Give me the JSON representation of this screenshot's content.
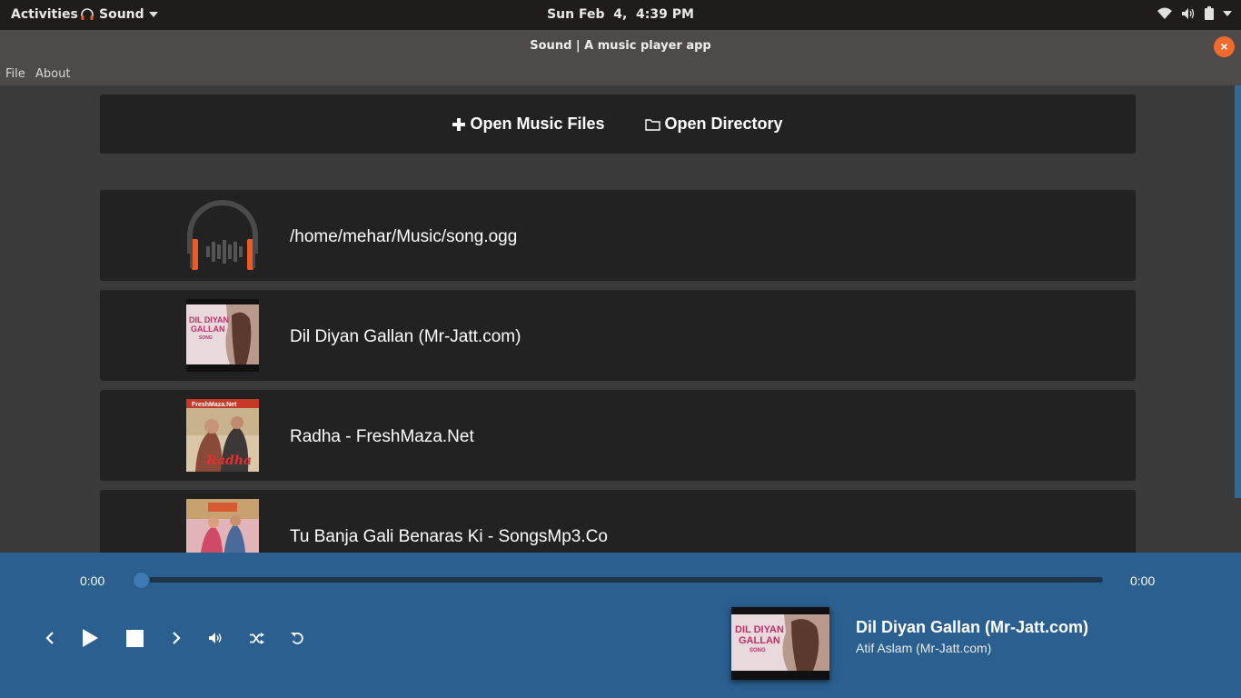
{
  "topbar": {
    "activities": "Activities",
    "app_name": "Sound",
    "clock": "Sun Feb  4,  4:39 PM",
    "icons": [
      "wifi-icon",
      "volume-icon",
      "battery-icon",
      "chevron-down-icon"
    ]
  },
  "window": {
    "title": "Sound | A music player app",
    "close_symbol": "×"
  },
  "menubar": {
    "items": [
      "File",
      "About"
    ]
  },
  "toolbar": {
    "open_files_label": "Open Music Files",
    "open_directory_label": "Open Directory"
  },
  "songs": [
    {
      "title": "/home/mehar/Music/song.ogg",
      "art": "headphones-placeholder-icon"
    },
    {
      "title": "Dil Diyan Gallan (Mr-Jatt.com)",
      "art": "album-art"
    },
    {
      "title": "Radha - FreshMaza.Net",
      "art": "album-art"
    },
    {
      "title": "Tu Banja Gali Benaras Ki - SongsMp3.Co",
      "art": "album-art"
    }
  ],
  "album_art_text": {
    "dil_diyan": [
      "DIL DIYAN",
      "GALLAN",
      "SONG"
    ],
    "radha_banner": "FreshMaza.Net",
    "radha_script": "Radha"
  },
  "player": {
    "elapsed": "0:00",
    "duration": "0:00",
    "progress": 0,
    "now_playing_title": "Dil Diyan Gallan (Mr-Jatt.com)",
    "now_playing_artist": "Atif Aslam (Mr-Jatt.com)"
  },
  "colors": {
    "accent": "#ef6b2d",
    "player_bg": "#2a5f8f",
    "row_bg": "#222222",
    "content_bg": "#3a3a3a",
    "scrollbar": "#2e6a9a"
  }
}
